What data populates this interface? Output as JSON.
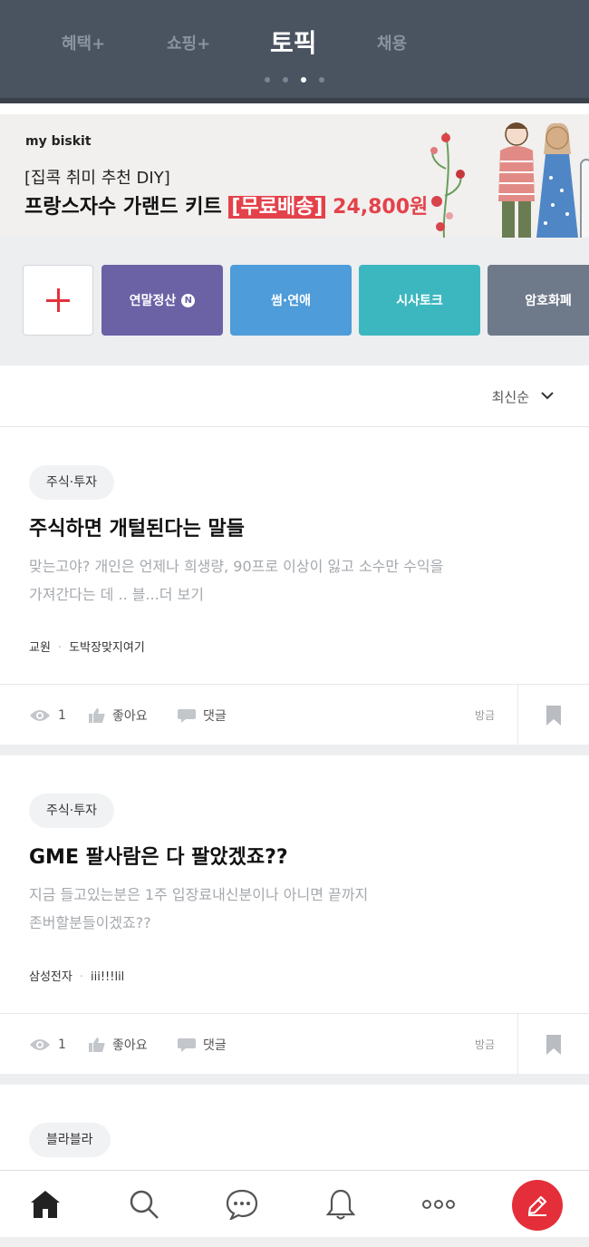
{
  "header": {
    "tabs": [
      {
        "label": "혜택+"
      },
      {
        "label": "쇼핑+"
      },
      {
        "label": "토픽"
      },
      {
        "label": "채용"
      }
    ]
  },
  "banner": {
    "brand": "my biskit",
    "subtitle": "[집콕 취미 추천 DIY]",
    "title_main": "프랑스자수 가랜드 키트",
    "title_highlight": "[무료배송]",
    "price": "24,800원"
  },
  "categories": {
    "items": [
      {
        "label": "연말정산",
        "badge": "N",
        "color": "#6b62a6"
      },
      {
        "label": "썸·연애",
        "color": "#4e9cd9"
      },
      {
        "label": "시사토크",
        "color": "#3db7bf"
      },
      {
        "label": "암호화폐",
        "color": "#6e7989"
      }
    ]
  },
  "sort": {
    "label": "최신순"
  },
  "posts": [
    {
      "tag": "주식·투자",
      "title": "주식하면 개털된다는 말들",
      "body_line1": "맞는고야? 개인은 언제나 희생량, 90프로 이상이 잃고 소수만 수익을",
      "body_line2": "가져간다는 데 ..  블...더 보기",
      "company": "교원",
      "author": "도박장맞지여기",
      "views": "1",
      "like_label": "좋아요",
      "comment_label": "댓글",
      "time": "방금"
    },
    {
      "tag": "주식·투자",
      "title": "GME 팔사람은 다 팔았겠죠??",
      "body_line1": "지금 들고있는분은 1주 입장료내신분이나  아니면 끝까지",
      "body_line2": "존버할분들이겠죠??",
      "company": "삼성전자",
      "author": "iii!!!lil",
      "views": "1",
      "like_label": "좋아요",
      "comment_label": "댓글",
      "time": "방금"
    },
    {
      "tag": "블라블라"
    }
  ],
  "nav": {
    "icons": [
      "home-icon",
      "search-icon",
      "chat-icon",
      "bell-icon",
      "more-icon",
      "write-icon"
    ]
  }
}
